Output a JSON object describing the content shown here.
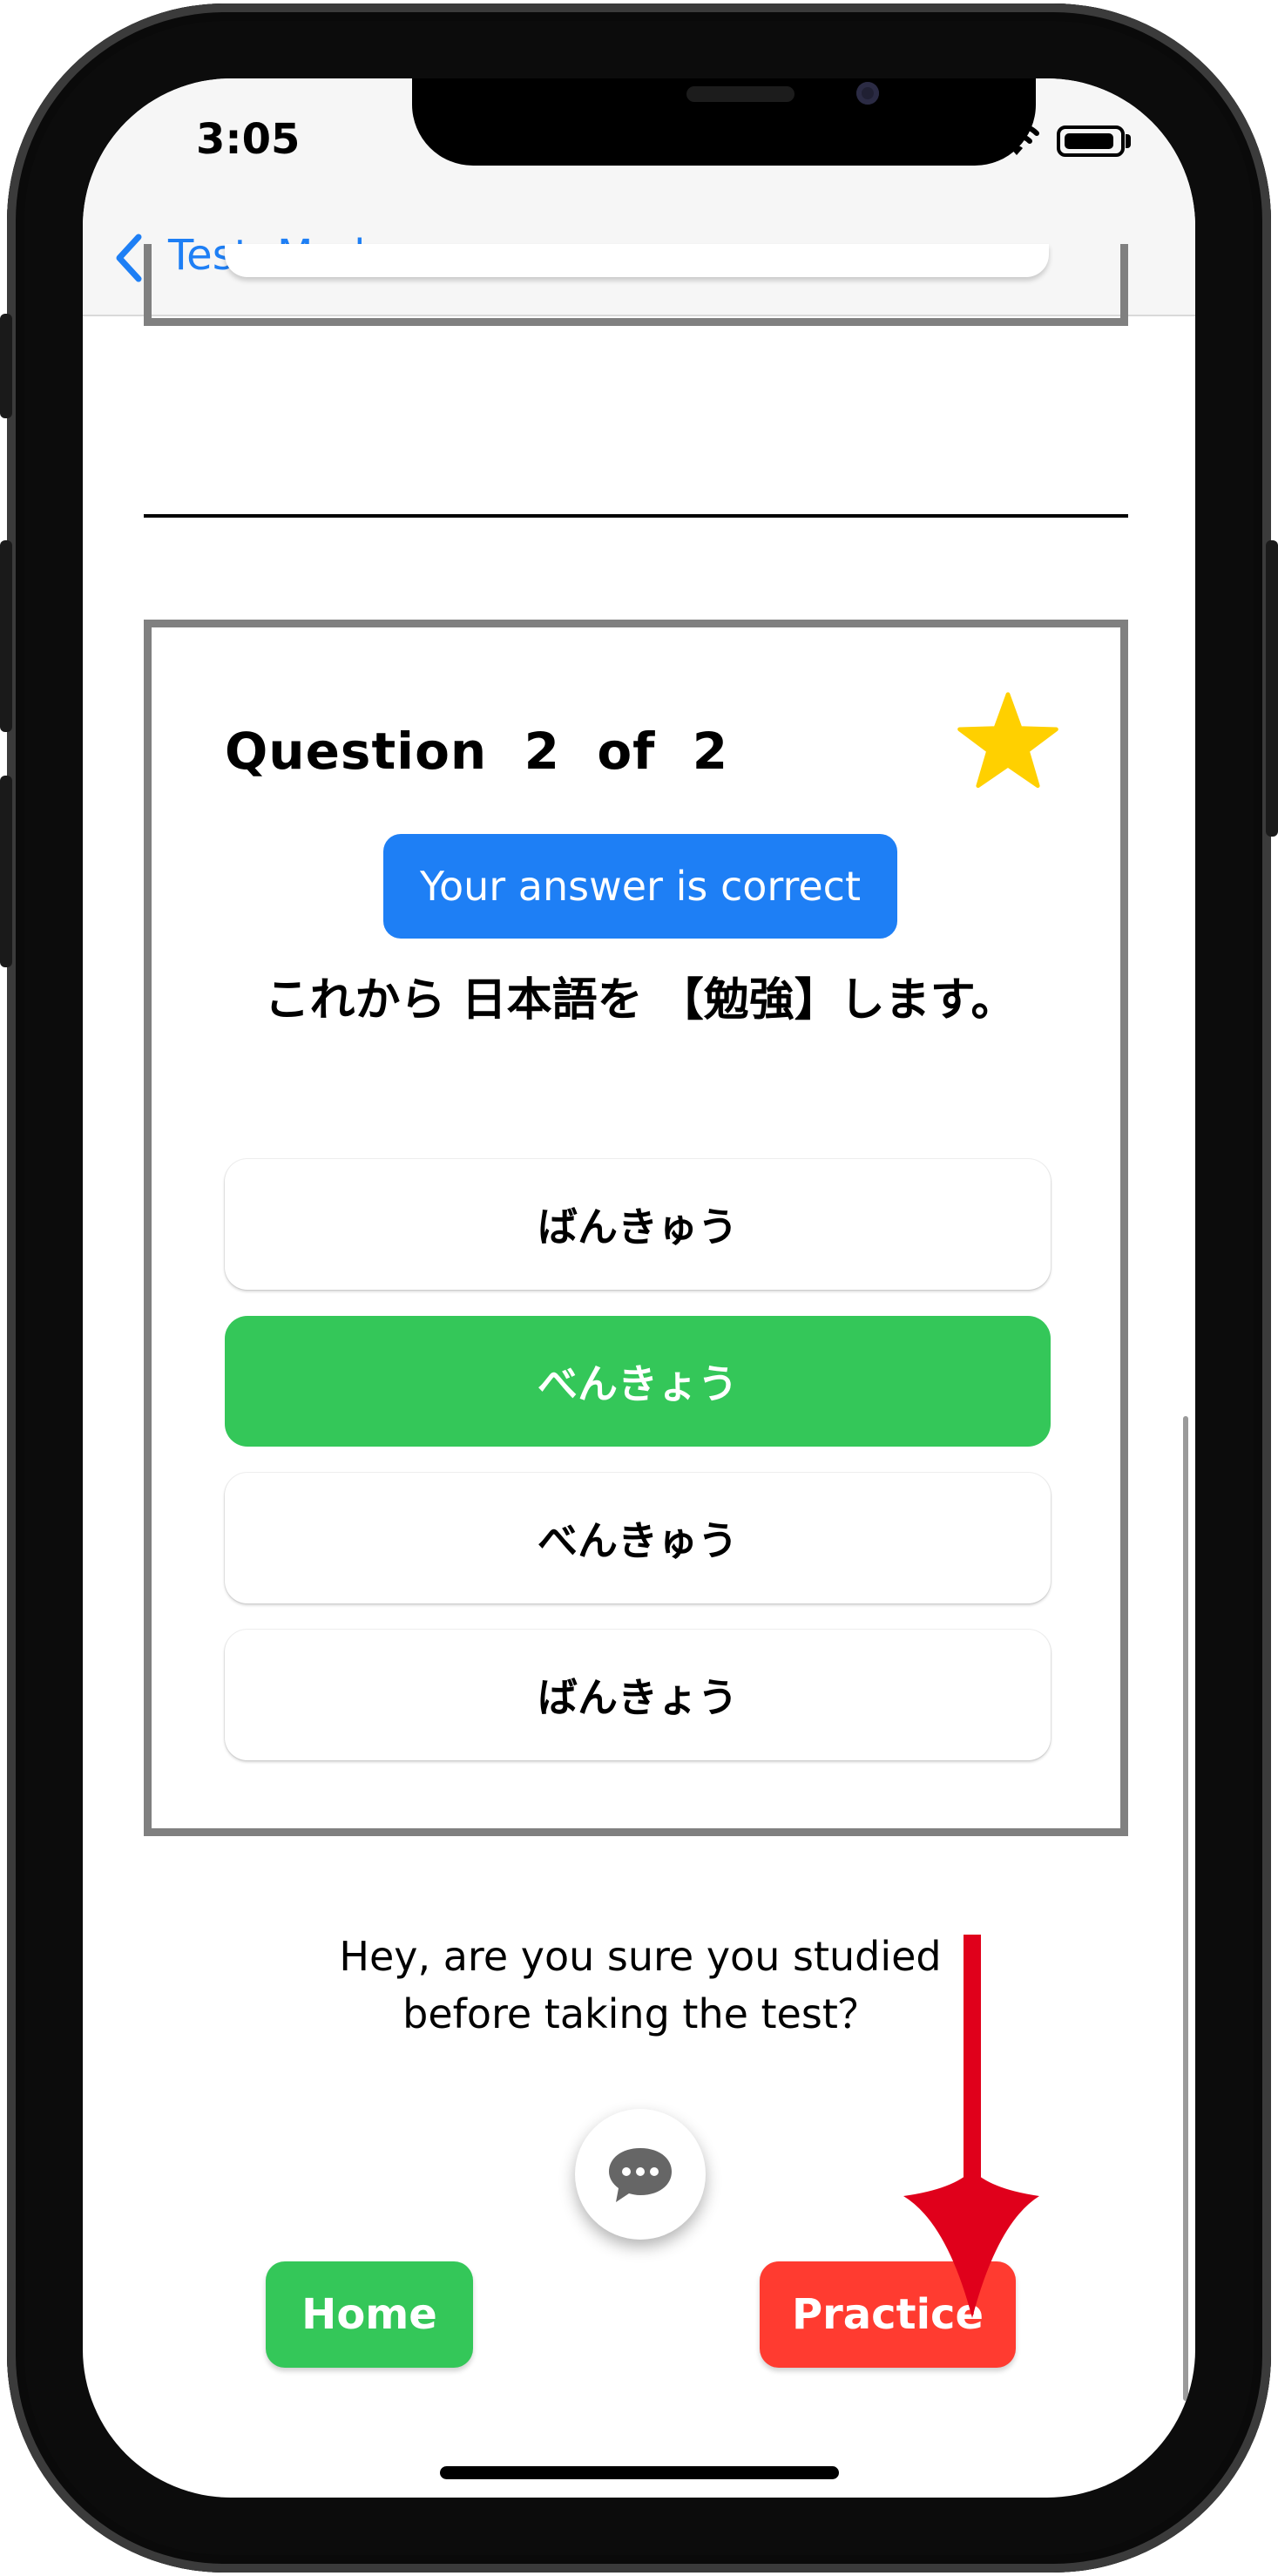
{
  "status_bar": {
    "time": "3:05"
  },
  "nav": {
    "back_label": "Test  Mode"
  },
  "question": {
    "title": "Question  2  of  2",
    "result_banner": "Your answer is correct",
    "sentence": "これから 日本語を 【勉強】します。",
    "options": [
      {
        "label": "ばんきゅう",
        "selected": false
      },
      {
        "label": "べんきょう",
        "selected": true
      },
      {
        "label": "べんきゅう",
        "selected": false
      },
      {
        "label": "ばんきょう",
        "selected": false
      }
    ],
    "favorite_star_color": "#ffd000"
  },
  "feedback": {
    "line1": "Hey, are you sure you studied",
    "line2": "before taking the test？"
  },
  "buttons": {
    "home": "Home",
    "practice": "Practice"
  },
  "colors": {
    "accent_blue": "#1e7ff5",
    "correct_green": "#34c759",
    "practice_red": "#ff3b30",
    "annotation_arrow": "#e0001b"
  }
}
